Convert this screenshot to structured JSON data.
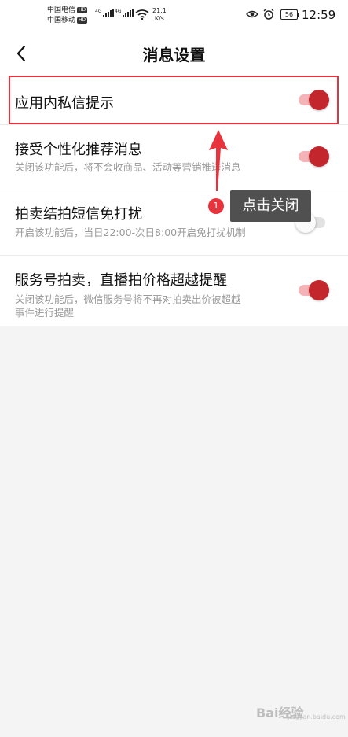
{
  "status_bar": {
    "carrier_1": "中国电信",
    "carrier_2": "中国移动",
    "hd": "HD",
    "network": "4G",
    "speed_value": "21.1",
    "speed_unit": "K/s",
    "battery": "56",
    "time": "12:59"
  },
  "header": {
    "title": "消息设置",
    "back_icon": "chevron-left-icon"
  },
  "settings": [
    {
      "title": "应用内私信提示",
      "description": "",
      "enabled": true
    },
    {
      "title": "接受个性化推荐消息",
      "description": "关闭该功能后，将不会收商品、活动等营销推送消息",
      "enabled": true
    },
    {
      "title": "拍卖结拍短信免打扰",
      "description": "开启该功能后，当日22:00-次日8:00开启免打扰机制",
      "enabled": false
    },
    {
      "title": "服务号拍卖，直播拍价格超越提醒",
      "description": "关闭该功能后，微信服务号将不再对拍卖出价被超越\n事件进行提醒",
      "enabled": true
    }
  ],
  "annotation": {
    "step_number": "1",
    "tooltip_text": "点击关闭",
    "highlight_color": "#e8333c"
  },
  "colors": {
    "toggle_on_knob": "#c4262d",
    "toggle_on_track": "#f4b3b6",
    "toggle_off_track": "#e2e2e2",
    "background": "#f4f4f4"
  },
  "watermark": {
    "text": "Bai经验",
    "sub": "jingyan.baidu.com"
  }
}
